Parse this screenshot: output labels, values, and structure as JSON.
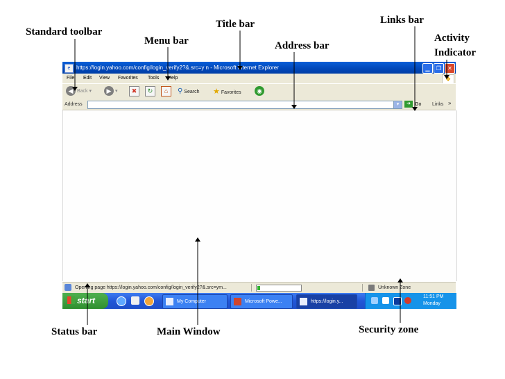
{
  "callouts": {
    "standard_toolbar": "Standard toolbar",
    "menu_bar": "Menu bar",
    "title_bar": "Title bar",
    "address_bar": "Address bar",
    "links_bar": "Links bar",
    "activity_indicator_1": "Activity",
    "activity_indicator_2": "Indicator",
    "status_bar": "Status bar",
    "main_window": "Main Window",
    "security_zone": "Security zone"
  },
  "window": {
    "title": "https://login.yahoo.com/config/login_verify2?&.src=y n - Microsoft Internet Explorer",
    "menu": [
      "File",
      "Edit",
      "View",
      "Favorites",
      "Tools",
      "Help"
    ],
    "toolbar": {
      "back": "Back",
      "search": "Search",
      "favorites": "Favorites"
    },
    "address": {
      "label": "Address",
      "value": "",
      "go": "Go",
      "links": "Links",
      "chevron": "»"
    },
    "status": {
      "text": "Opening page https://login.yahoo.com/config/login_verify2?&.src=ym...",
      "progress": 0.06,
      "zone": "Unknown Zone"
    }
  },
  "taskbar": {
    "start": "start",
    "tasks": [
      {
        "label": "My Computer"
      },
      {
        "label": "Microsoft Powe..."
      },
      {
        "label": "https://login.y..."
      }
    ],
    "clock": {
      "time": "11:51 PM",
      "day": "Monday"
    }
  },
  "colors": {
    "title_bar": "#0046b8",
    "chrome": "#ece9d8",
    "taskbar": "#2257d8",
    "start_button": "#2f8f2f",
    "close_button": "#d9472b",
    "progress_fill": "#2fb42f"
  }
}
